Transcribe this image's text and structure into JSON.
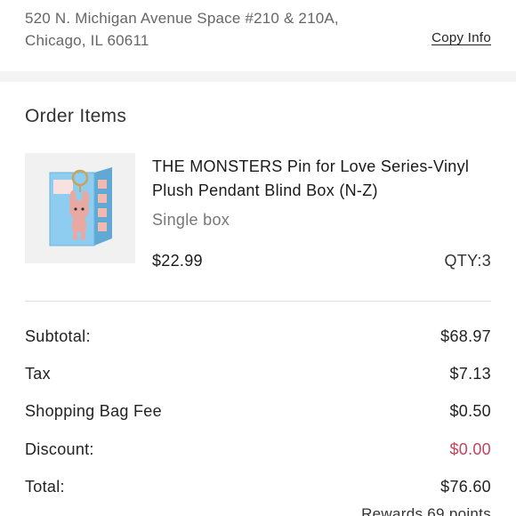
{
  "store": {
    "address_line1": "520 N. Michigan Avenue Space #210 & 210A,",
    "address_line2": "Chicago, IL 60611",
    "copy_info_label": "Copy Info"
  },
  "order_items": {
    "title": "Order Items",
    "items": [
      {
        "name": "THE MONSTERS Pin for Love Series-Vinyl Plush Pendant Blind Box (N-Z)",
        "variant": "Single box",
        "price": "$22.99",
        "qty_label": "QTY:",
        "qty": "3",
        "thumbnail_icon": "blind-box-product-image"
      }
    ]
  },
  "summary": {
    "subtotal_label": "Subtotal:",
    "subtotal_value": "$68.97",
    "tax_label": "Tax",
    "tax_value": "$7.13",
    "bag_fee_label": "Shopping Bag Fee",
    "bag_fee_value": "$0.50",
    "discount_label": "Discount:",
    "discount_value": "$0.00",
    "total_label": "Total:",
    "total_value": "$76.60",
    "rewards_text": "Rewards 69 points"
  },
  "colors": {
    "discount": "#c0455d",
    "box_blue": "#7cc3e8",
    "figure_pink": "#e9a9a3"
  }
}
